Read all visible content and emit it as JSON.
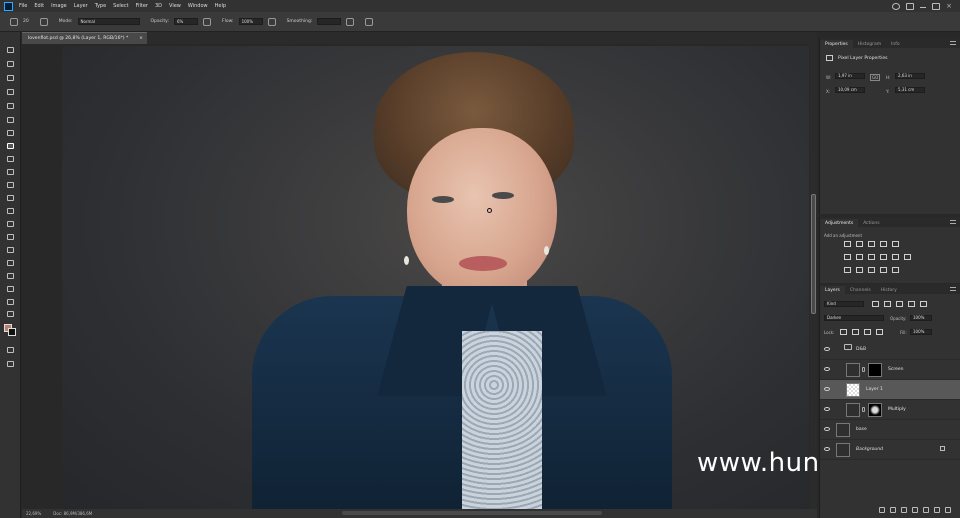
{
  "menu": [
    "File",
    "Edit",
    "Image",
    "Layer",
    "Type",
    "Select",
    "Filter",
    "3D",
    "View",
    "Window",
    "Help"
  ],
  "options": {
    "brush_size": "20",
    "mode_label": "Mode:",
    "mode_value": "Normal",
    "opacity_label": "Opacity:",
    "opacity_value": "6%",
    "flow_label": "Flow:",
    "flow_value": "100%",
    "smoothing_label": "Smoothing:",
    "smoothing_value": ""
  },
  "document": {
    "tab_title": "lovenflot.psd @ 26,8% (Layer 1, RGB/16*) *",
    "close": "×"
  },
  "status": {
    "zoom": "22,69%",
    "doc_info": "Doc: 86,9M/386,6M"
  },
  "watermark": "www.hunls.com",
  "properties": {
    "tabs": [
      "Properties",
      "Histogram",
      "Info"
    ],
    "header": "Pixel Layer Properties",
    "w_label": "W:",
    "w_value": "1,97 in",
    "h_label": "H:",
    "h_value": "2,63 in",
    "x_label": "X:",
    "x_value": "10,09 cm",
    "y_label": "Y:",
    "y_value": "5,31 cm",
    "go_label": "GO"
  },
  "adjustments": {
    "tabs": [
      "Adjustments",
      "Actions"
    ],
    "header": "Add an adjustment"
  },
  "layers_panel": {
    "tabs": [
      "Layers",
      "Channels",
      "History"
    ],
    "kind_label": "Kind",
    "blend_mode": "Darken",
    "opacity_label": "Opacity:",
    "opacity_value": "100%",
    "lock_label": "Lock:",
    "fill_label": "Fill:",
    "fill_value": "100%",
    "layers": [
      {
        "name": "D&B"
      },
      {
        "name": "Screen"
      },
      {
        "name": "Layer 1"
      },
      {
        "name": "Multiply"
      },
      {
        "name": "base"
      },
      {
        "name": "Background"
      }
    ]
  },
  "colors": {
    "foreground": "#b98074",
    "background": "#111111",
    "accent": "#31a8ff"
  }
}
